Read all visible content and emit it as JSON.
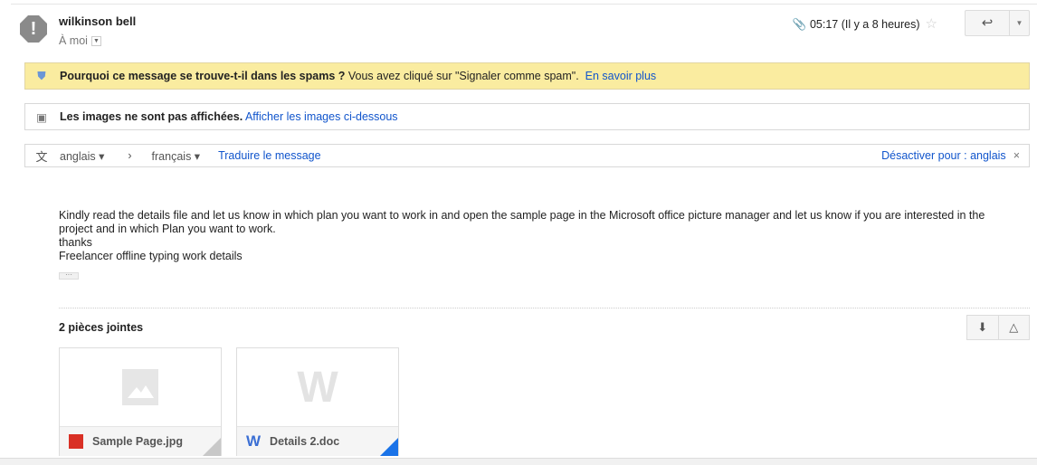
{
  "header": {
    "sender": "wilkinson bell",
    "recipient": "À moi",
    "time": "05:17 (Il y a 8 heures)"
  },
  "spam": {
    "title": "Pourquoi ce message se trouve-t-il dans les spams ?",
    "text": "Vous avez cliqué sur \"Signaler comme spam\".",
    "link": "En savoir plus"
  },
  "images": {
    "text": "Les images ne sont pas affichées.",
    "link": "Afficher les images ci-dessous"
  },
  "translate": {
    "from": "anglais",
    "to": "français",
    "action": "Traduire le message",
    "disable": "Désactiver pour : anglais"
  },
  "body": {
    "lines": [
      "Kindly read the details file and let us know in which plan you want to work in and open the sample page in the Microsoft office picture manager and let us know if you are interested in the project and in which Plan you want to work.",
      "thanks",
      "Freelancer offline typing work details"
    ]
  },
  "attachments": {
    "title": "2 pièces jointes",
    "items": [
      {
        "name": "Sample Page.jpg"
      },
      {
        "name": "Details 2.doc"
      }
    ]
  }
}
